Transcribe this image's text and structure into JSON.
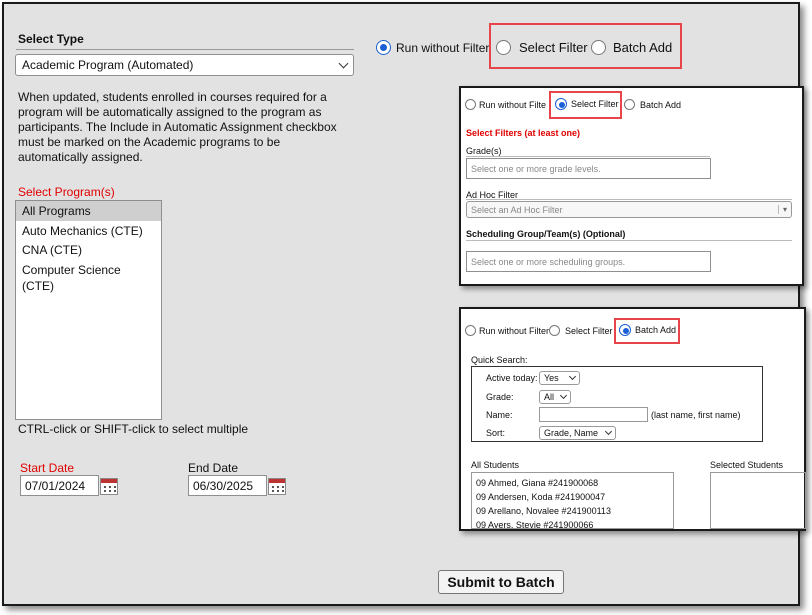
{
  "main": {
    "select_type_label": "Select Type",
    "type_value": "Academic Program (Automated)",
    "description": "When updated, students enrolled in courses required for a program will be automatically assigned to the program as participants. The Include in Automatic Assignment checkbox must be marked on the Academic programs to be automatically assigned.",
    "desc_lines": [
      "When updated, students enrolled in courses required for a",
      "program will be automatically assigned to the program as",
      "participants. The Include in Automatic Assignment checkbox",
      "must be marked on the Academic programs to be",
      "automatically assigned."
    ],
    "programs_label": "Select Program(s)",
    "programs": [
      "All Programs",
      "Auto Mechanics (CTE)",
      "CNA (CTE)",
      "Computer Science (CTE)"
    ],
    "multi_hint": "CTRL-click or SHIFT-click to select multiple",
    "start_date_label": "Start Date",
    "start_date": "07/01/2024",
    "end_date_label": "End Date",
    "end_date": "06/30/2025",
    "submit_label": "Submit to Batch",
    "radio_run": "Run without Filter",
    "radio_select": "Select Filter",
    "radio_batch": "Batch Add"
  },
  "inset_filter": {
    "radio_run": "Run without Filte",
    "radio_select": "Select Filter",
    "radio_batch": "Batch Add",
    "heading": "Select Filters (at least one)",
    "grades_label": "Grade(s)",
    "grades_placeholder": "Select one or more grade levels.",
    "adhoc_label": "Ad Hoc Filter",
    "adhoc_placeholder": "Select an Ad Hoc Filter",
    "sched_label": "Scheduling Group/Team(s) (Optional)",
    "sched_placeholder": "Select one or more scheduling groups."
  },
  "inset_batch": {
    "radio_run": "Run without Filter",
    "radio_select": "Select Filter",
    "radio_batch": "Batch Add",
    "quick_search_label": "Quick Search:",
    "active_label": "Active today:",
    "active_value": "Yes",
    "grade_label": "Grade:",
    "grade_value": "All",
    "name_label": "Name:",
    "name_hint": "(last name, first name)",
    "sort_label": "Sort:",
    "sort_value": "Grade, Name",
    "all_students_label": "All Students",
    "selected_students_label": "Selected Students",
    "students": [
      "09 Ahmed, Giana  #241900068",
      "09 Andersen, Koda  #241900047",
      "09 Arellano, Novalee  #241900113",
      "09 Ayers, Stevie  #241900066"
    ]
  },
  "colors": {
    "highlight": "#e8454a",
    "required": "#e00000",
    "radio": "#1a5fd6"
  }
}
